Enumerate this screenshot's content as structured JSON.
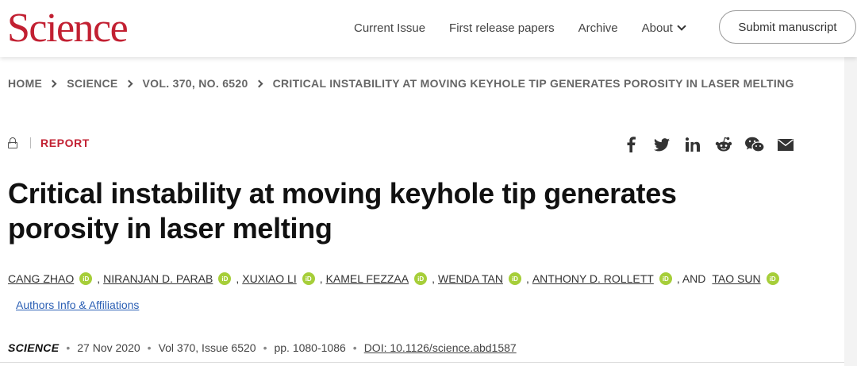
{
  "header": {
    "logo": "Science",
    "nav": [
      "Current Issue",
      "First release papers",
      "Archive",
      "About"
    ],
    "submit_label": "Submit manuscript"
  },
  "breadcrumb": [
    "HOME",
    "SCIENCE",
    "VOL. 370, NO. 6520",
    "CRITICAL INSTABILITY AT MOVING KEYHOLE TIP GENERATES POROSITY IN LASER MELTING"
  ],
  "article": {
    "type_label": "REPORT",
    "title_line1": "Critical instability at moving keyhole tip generates",
    "title_line2": "porosity in laser melting",
    "authors": [
      "CANG ZHAO",
      "NIRANJAN D. PARAB",
      "XUXIAO LI",
      "KAMEL FEZZAA",
      "WENDA TAN",
      "ANTHONY D. ROLLETT",
      "TAO SUN"
    ],
    "and_label": ", AND",
    "orcid_glyph": "iD",
    "affiliations_link": "Authors Info & Affiliations",
    "journal": "SCIENCE",
    "date": "27 Nov 2020",
    "volume": "Vol 370, Issue 6520",
    "pages": "pp. 1080-1086",
    "doi": "DOI: 10.1126/science.abd1587"
  },
  "share_icons": [
    "facebook-icon",
    "twitter-icon",
    "linkedin-icon",
    "reddit-icon",
    "wechat-icon",
    "email-icon"
  ],
  "colors": {
    "brand": "#c22032",
    "link": "#2b5fb4",
    "orcid": "#a6ce39"
  }
}
